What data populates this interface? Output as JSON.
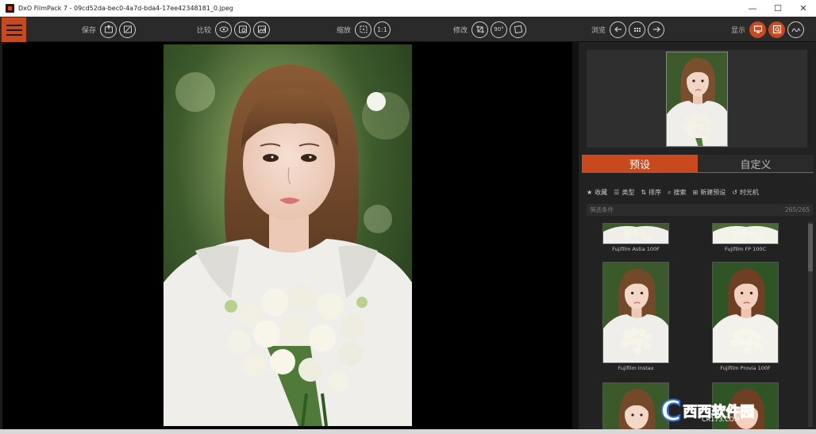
{
  "window": {
    "title": "DxO FilmPack 7 - 09cd52da-bec0-4a7d-bda4-17ee42348181_0.jpeg",
    "minimize": "—",
    "maximize": "☐",
    "close": "✕"
  },
  "toolbar": {
    "save_label": "保存",
    "compare_label": "比较",
    "zoom_label": "缩放",
    "zoom_value": "1:1",
    "edit_label": "修改",
    "rotate_label": "90°",
    "browse_label": "浏览",
    "display_label": "显示"
  },
  "panel": {
    "tabs": [
      {
        "label": "预设",
        "active": true
      },
      {
        "label": "自定义",
        "active": false
      }
    ],
    "tools": [
      "收藏",
      "类型",
      "排序",
      "搜索",
      "新建预设",
      "时光机"
    ],
    "filter_placeholder": "筛选条件",
    "filter_count": "265/265",
    "presets": [
      {
        "name": "Fujifilm Astia 100F"
      },
      {
        "name": "Fujifilm FP 100C"
      },
      {
        "name": "Fujifilm Instax"
      },
      {
        "name": "Fujifilm Provia 100F"
      }
    ]
  },
  "watermark": {
    "main": "西西软件园",
    "sub": "CR173.COM"
  },
  "colors": {
    "accent": "#c8491d",
    "panel_bg": "#222222",
    "toolbar_bg": "#2a2a2a"
  }
}
